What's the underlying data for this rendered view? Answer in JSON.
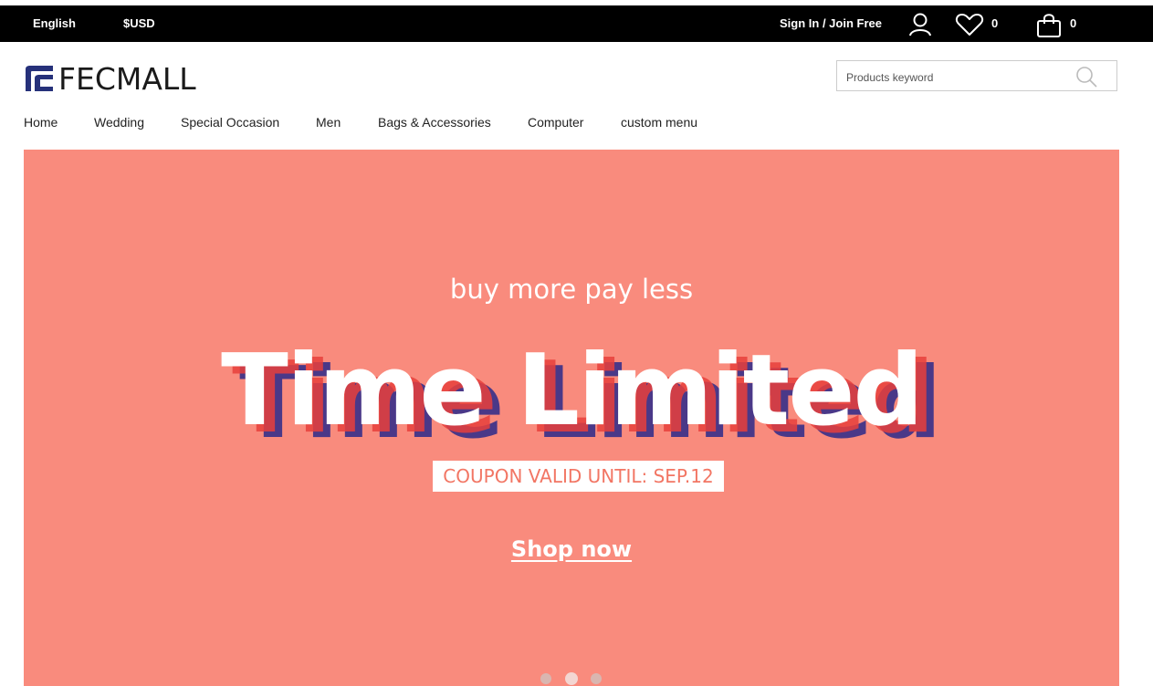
{
  "topbar": {
    "language": "English",
    "currency": "$USD",
    "signin": "Sign In / Join Free",
    "wishlist_count": "0",
    "cart_count": "0"
  },
  "header": {
    "logo_text": "FECMALL",
    "search_placeholder": "Products keyword"
  },
  "nav": {
    "items": [
      "Home",
      "Wedding",
      "Special Occasion",
      "Men",
      "Bags & Accessories",
      "Computer",
      "custom menu"
    ]
  },
  "banner": {
    "background": "#f98b7d",
    "subtitle": "buy more pay less",
    "headline": "Time Limited",
    "coupon": "COUPON VALID UNTIL: SEP.12",
    "cta": "Shop now",
    "slides": 3,
    "active_slide": 2
  },
  "icons": {
    "user": "user-icon",
    "wishlist": "heart-icon",
    "cart": "shopping-bag-icon",
    "search": "search-icon"
  }
}
